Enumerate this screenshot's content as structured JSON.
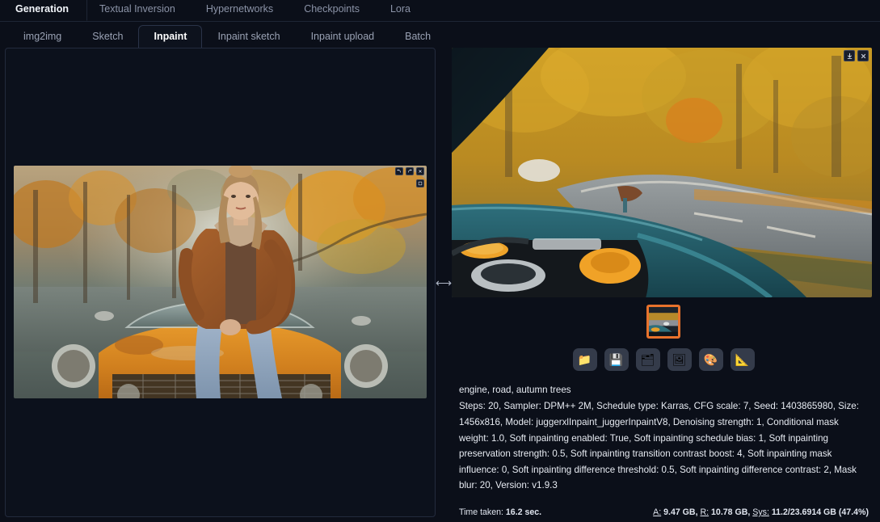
{
  "main_tabs": [
    {
      "label": "Generation",
      "active": true
    },
    {
      "label": "Textual Inversion",
      "active": false
    },
    {
      "label": "Hypernetworks",
      "active": false
    },
    {
      "label": "Checkpoints",
      "active": false
    },
    {
      "label": "Lora",
      "active": false
    }
  ],
  "sub_tabs": [
    {
      "label": "img2img",
      "active": false
    },
    {
      "label": "Sketch",
      "active": false
    },
    {
      "label": "Inpaint",
      "active": true
    },
    {
      "label": "Inpaint sketch",
      "active": false
    },
    {
      "label": "Inpaint upload",
      "active": false
    },
    {
      "label": "Batch",
      "active": false
    }
  ],
  "canvas": {
    "tools": [
      "undo-icon",
      "redo-icon",
      "remove-icon",
      "edit-icon"
    ],
    "image_alt": "woman in brown leather jacket sitting on orange vintage car by autumn lake"
  },
  "splitter": {
    "handle": "⧉"
  },
  "preview": {
    "image_alt": "car engine bay with open hood on autumn road",
    "actions": [
      {
        "name": "download-icon",
        "label": "⬇"
      },
      {
        "name": "close-icon",
        "label": "✕"
      }
    ],
    "thumbnails": [
      {
        "selected": true,
        "alt": "engine bay thumbnail"
      }
    ],
    "accent_color": "#e8722c"
  },
  "toolbar": [
    {
      "name": "open-folder-button",
      "glyph": "📁"
    },
    {
      "name": "save-button",
      "glyph": "💾"
    },
    {
      "name": "save-zip-button",
      "glyph": "🗂"
    },
    {
      "name": "send-to-img2img-button",
      "glyph": "🖼"
    },
    {
      "name": "send-to-inpaint-button",
      "glyph": "🎨"
    },
    {
      "name": "send-to-extras-button",
      "glyph": "📐"
    }
  ],
  "params": {
    "prompt": "engine, road, autumn trees",
    "meta": "Steps: 20, Sampler: DPM++ 2M, Schedule type: Karras, CFG scale: 7, Seed: 1403865980, Size: 1456x816, Model: juggerxlInpaint_juggerInpaintV8, Denoising strength: 1, Conditional mask weight: 1.0, Soft inpainting enabled: True, Soft inpainting schedule bias: 1, Soft inpainting preservation strength: 0.5, Soft inpainting transition contrast boost: 4, Soft inpainting mask influence: 0, Soft inpainting difference threshold: 0.5, Soft inpainting difference contrast: 2, Mask blur: 20, Version: v1.9.3"
  },
  "stats": {
    "time_label": "Time taken:",
    "time_value": "16.2 sec.",
    "mem_a_label": "A:",
    "mem_a_value": "9.47 GB,",
    "mem_r_label": "R:",
    "mem_r_value": "10.78 GB,",
    "mem_sys_label": "Sys:",
    "mem_sys_value": "11.2/23.6914 GB (47.4%)"
  }
}
